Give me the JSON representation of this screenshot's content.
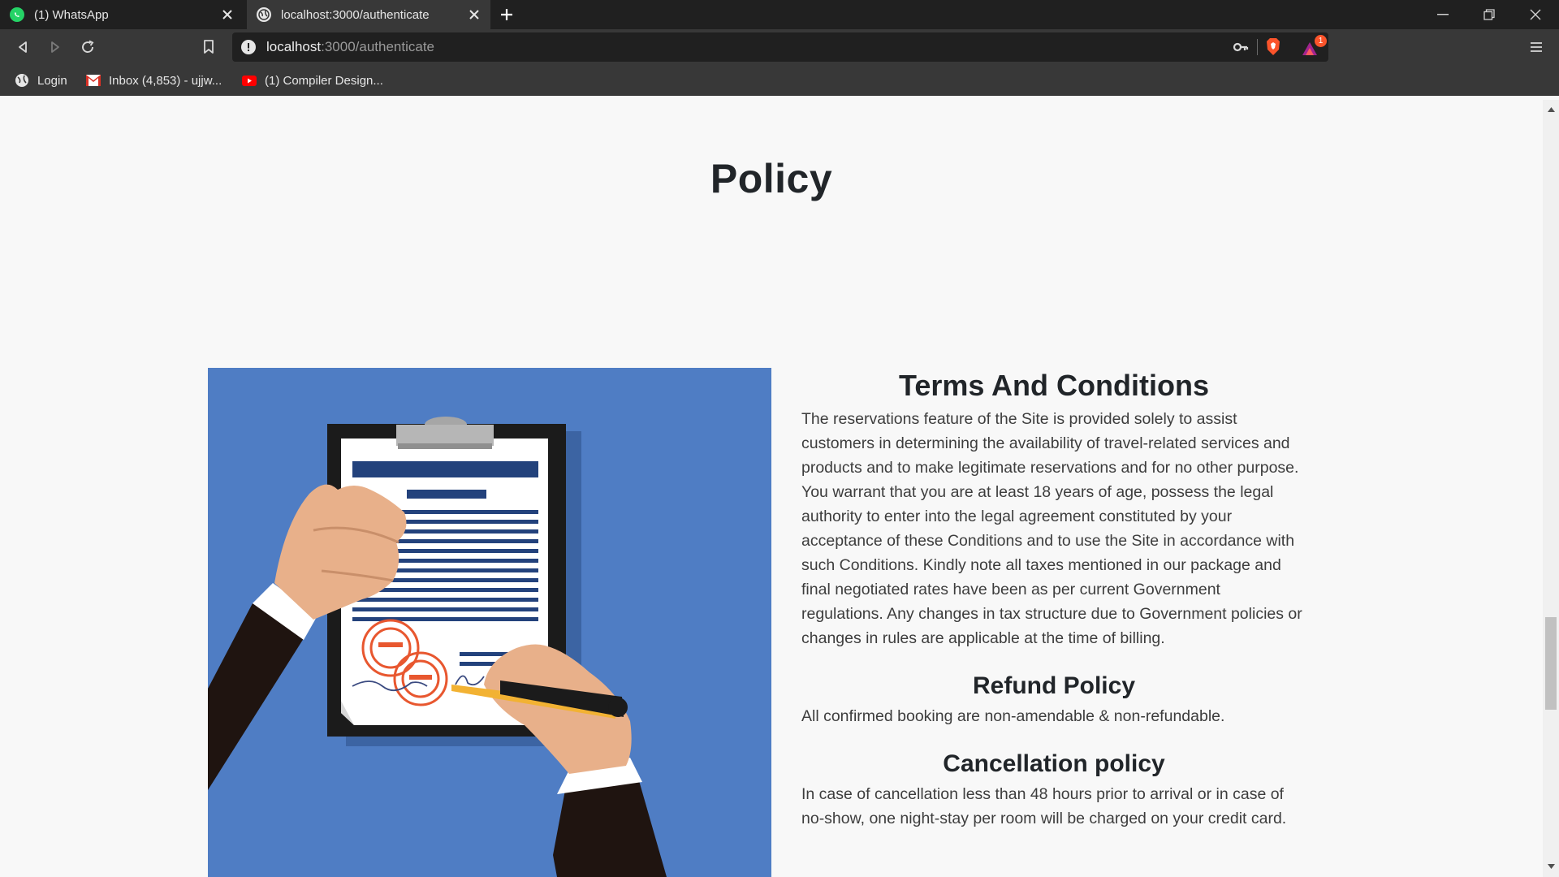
{
  "browser": {
    "tabs": [
      {
        "title": "(1) WhatsApp",
        "icon": "whatsapp-icon",
        "active": false
      },
      {
        "title": "localhost:3000/authenticate",
        "icon": "globe-icon",
        "active": true
      }
    ],
    "address": {
      "host": "localhost",
      "path": ":3000/authenticate"
    },
    "bookmarks": [
      {
        "label": "Login",
        "icon": "globe-icon"
      },
      {
        "label": "Inbox (4,853) - ujjw...",
        "icon": "gmail-icon"
      },
      {
        "label": "(1) Compiler Design...",
        "icon": "youtube-icon"
      }
    ],
    "notification_count": "1"
  },
  "page": {
    "title": "Policy",
    "sections": [
      {
        "heading": "Terms And Conditions",
        "body": "The reservations feature of the Site is provided solely to assist customers in determining the availability of travel-related services and products and to make legitimate reservations and for no other purpose. You warrant that you are at least 18 years of age, possess the legal authority to enter into the legal agreement constituted by your acceptance of these Conditions and to use the Site in accordance with such Conditions. Kindly note all taxes mentioned in our package and final negotiated rates have been as per current Government regulations. Any changes in tax structure due to Government policies or changes in rules are applicable at the time of billing."
      },
      {
        "heading": "Refund Policy",
        "body": "All confirmed booking are non-amendable & non-refundable."
      },
      {
        "heading": "Cancellation policy",
        "body": "In case of cancellation less than 48 hours prior to arrival or in case of no-show, one night-stay per room will be charged on your credit card."
      }
    ]
  },
  "colors": {
    "illustration_bg": "#4f7dc4",
    "heading": "#212529",
    "body_text": "#3d3d3d",
    "chrome_dark": "#202020",
    "chrome_toolbar": "#383838"
  }
}
